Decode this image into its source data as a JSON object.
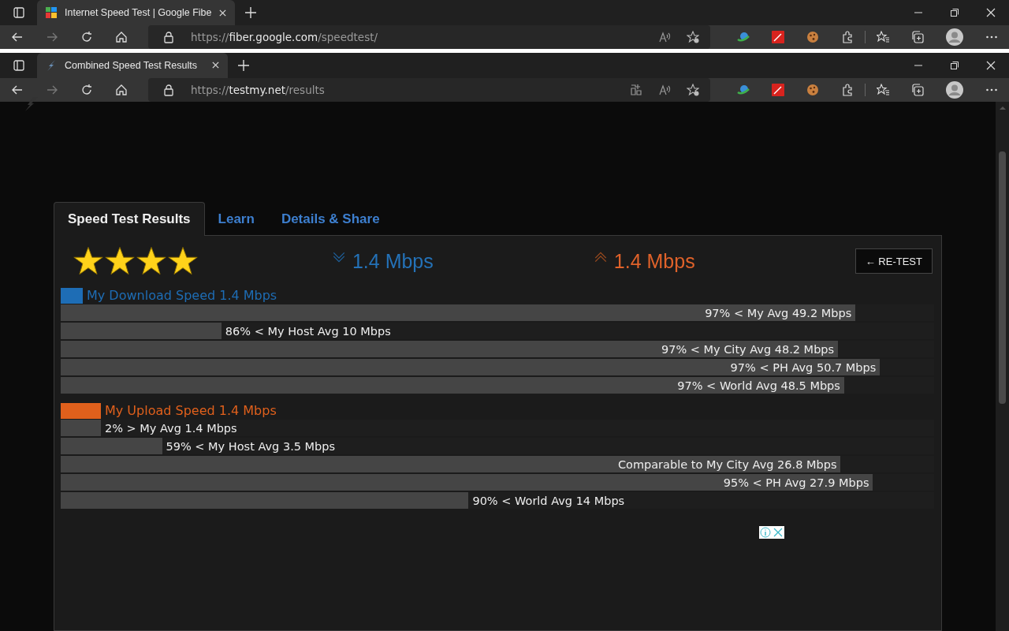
{
  "browser_windows": [
    {
      "tab": {
        "title": "Internet Speed Test | Google Fibe",
        "kind": "multicolor",
        "selected": true
      },
      "url": {
        "scheme": "https://",
        "host": "fiber.google.com",
        "path": "/speedtest/"
      },
      "install_app_button": false
    },
    {
      "tab": {
        "title": "Combined Speed Test Results",
        "kind": "lightning",
        "selected": true
      },
      "url": {
        "scheme": "https://",
        "host": "testmy.net",
        "path": "/results"
      },
      "install_app_button": true
    }
  ],
  "page": {
    "tabs": [
      {
        "label": "Speed Test Results",
        "selected": true
      },
      {
        "label": "Learn",
        "selected": false
      },
      {
        "label": "Details & Share",
        "selected": false
      }
    ],
    "stars": 4,
    "download_reading": "1.4 Mbps",
    "upload_reading": "1.4 Mbps",
    "retest_button": "← RE-TEST",
    "sections": [
      {
        "kind": "download",
        "title": "My Download Speed 1.4 Mbps",
        "color": "#1e6db5",
        "bars": [
          {
            "label": "97% < My Avg 49.2 Mbps",
            "level": 0.91
          },
          {
            "label": "86% < My Host Avg 10 Mbps",
            "level": 0.184
          },
          {
            "label": "97% < My City Avg 48.2 Mbps",
            "level": 0.89
          },
          {
            "label": "97% < PH Avg 50.7 Mbps",
            "level": 0.938
          },
          {
            "label": "97% < World Avg 48.5 Mbps",
            "level": 0.897
          }
        ]
      },
      {
        "kind": "upload",
        "title": "My Upload Speed 1.4 Mbps",
        "color": "#e0601c",
        "bars": [
          {
            "label": "2% > My Avg 1.4 Mbps",
            "level": 0.046
          },
          {
            "label": "59% < My Host Avg 3.5 Mbps",
            "level": 0.116
          },
          {
            "label": "Comparable to My City Avg 26.8 Mbps",
            "level": 0.893
          },
          {
            "label": "95% < PH Avg 27.9 Mbps",
            "level": 0.93
          },
          {
            "label": "90% < World Avg 14 Mbps",
            "level": 0.467
          }
        ]
      }
    ]
  }
}
